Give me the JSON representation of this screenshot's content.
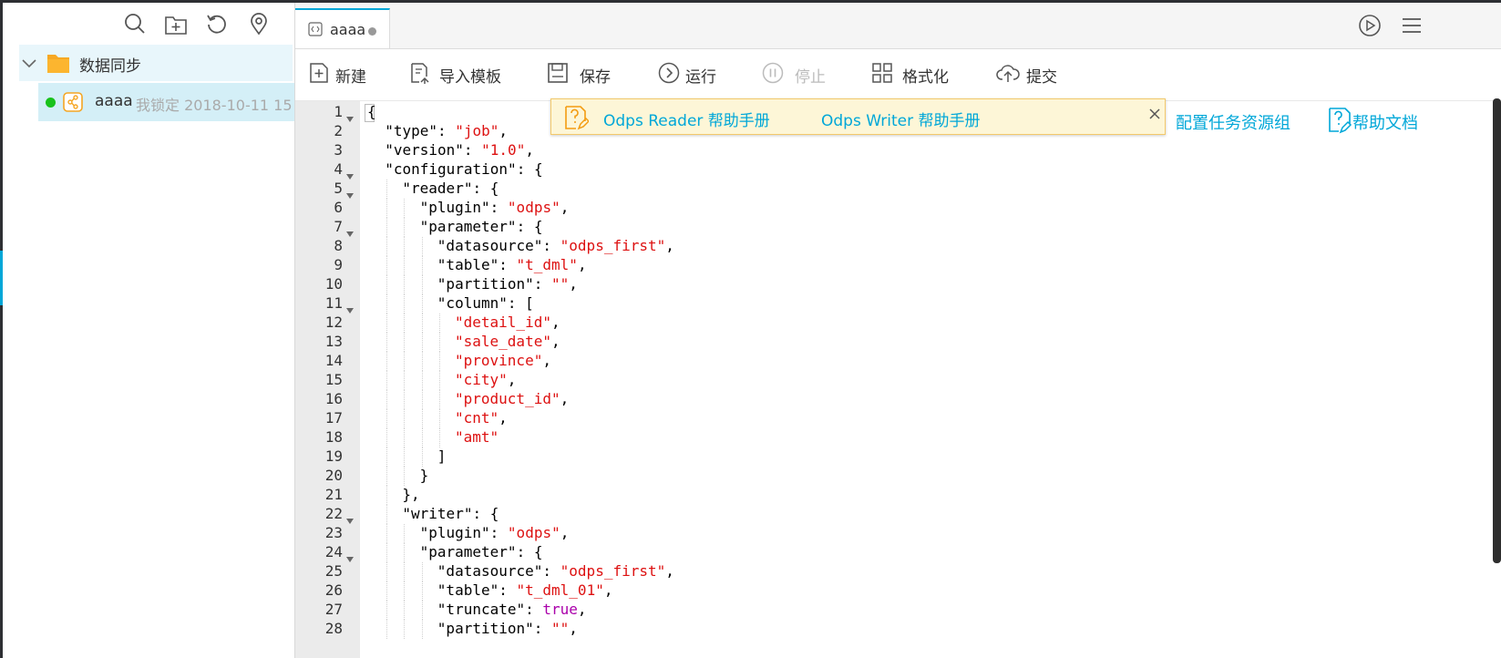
{
  "sidebar": {
    "folder": {
      "label": "数据同步"
    },
    "item": {
      "name": "aaaa",
      "lock_info": "我锁定 2018-10-11 15"
    },
    "tools": [
      "search-icon",
      "new-folder-icon",
      "refresh-icon",
      "locate-icon"
    ]
  },
  "tab": {
    "label": "aaaa"
  },
  "toolbar": {
    "new": "新建",
    "import_template": "导入模板",
    "save": "保存",
    "run": "运行",
    "stop": "停止",
    "format": "格式化",
    "submit": "提交"
  },
  "banner": {
    "reader_link": "Odps Reader 帮助手册",
    "writer_link": "Odps Writer 帮助手册"
  },
  "side_links": {
    "resource_group": "配置任务资源组",
    "help_doc": "帮助文档"
  },
  "editor": {
    "lines": [
      {
        "n": "1",
        "fold": true,
        "indent": 0,
        "parts": [
          [
            "p",
            "{"
          ]
        ]
      },
      {
        "n": "2",
        "fold": false,
        "indent": 1,
        "parts": [
          [
            "k",
            "\"type\""
          ],
          [
            "p",
            ": "
          ],
          [
            "s",
            "\"job\""
          ],
          [
            "p",
            ","
          ]
        ]
      },
      {
        "n": "3",
        "fold": false,
        "indent": 1,
        "parts": [
          [
            "k",
            "\"version\""
          ],
          [
            "p",
            ": "
          ],
          [
            "s",
            "\"1.0\""
          ],
          [
            "p",
            ","
          ]
        ]
      },
      {
        "n": "4",
        "fold": true,
        "indent": 1,
        "parts": [
          [
            "k",
            "\"configuration\""
          ],
          [
            "p",
            ": {"
          ]
        ]
      },
      {
        "n": "5",
        "fold": true,
        "indent": 2,
        "parts": [
          [
            "k",
            "\"reader\""
          ],
          [
            "p",
            ": {"
          ]
        ]
      },
      {
        "n": "6",
        "fold": false,
        "indent": 3,
        "parts": [
          [
            "k",
            "\"plugin\""
          ],
          [
            "p",
            ": "
          ],
          [
            "s",
            "\"odps\""
          ],
          [
            "p",
            ","
          ]
        ]
      },
      {
        "n": "7",
        "fold": true,
        "indent": 3,
        "parts": [
          [
            "k",
            "\"parameter\""
          ],
          [
            "p",
            ": {"
          ]
        ]
      },
      {
        "n": "8",
        "fold": false,
        "indent": 4,
        "parts": [
          [
            "k",
            "\"datasource\""
          ],
          [
            "p",
            ": "
          ],
          [
            "s",
            "\"odps_first\""
          ],
          [
            "p",
            ","
          ]
        ]
      },
      {
        "n": "9",
        "fold": false,
        "indent": 4,
        "parts": [
          [
            "k",
            "\"table\""
          ],
          [
            "p",
            ": "
          ],
          [
            "s",
            "\"t_dml\""
          ],
          [
            "p",
            ","
          ]
        ]
      },
      {
        "n": "10",
        "fold": false,
        "indent": 4,
        "parts": [
          [
            "k",
            "\"partition\""
          ],
          [
            "p",
            ": "
          ],
          [
            "s",
            "\"\""
          ],
          [
            "p",
            ","
          ]
        ]
      },
      {
        "n": "11",
        "fold": true,
        "indent": 4,
        "parts": [
          [
            "k",
            "\"column\""
          ],
          [
            "p",
            ": ["
          ]
        ]
      },
      {
        "n": "12",
        "fold": false,
        "indent": 5,
        "parts": [
          [
            "s",
            "\"detail_id\""
          ],
          [
            "p",
            ","
          ]
        ]
      },
      {
        "n": "13",
        "fold": false,
        "indent": 5,
        "parts": [
          [
            "s",
            "\"sale_date\""
          ],
          [
            "p",
            ","
          ]
        ]
      },
      {
        "n": "14",
        "fold": false,
        "indent": 5,
        "parts": [
          [
            "s",
            "\"province\""
          ],
          [
            "p",
            ","
          ]
        ]
      },
      {
        "n": "15",
        "fold": false,
        "indent": 5,
        "parts": [
          [
            "s",
            "\"city\""
          ],
          [
            "p",
            ","
          ]
        ]
      },
      {
        "n": "16",
        "fold": false,
        "indent": 5,
        "parts": [
          [
            "s",
            "\"product_id\""
          ],
          [
            "p",
            ","
          ]
        ]
      },
      {
        "n": "17",
        "fold": false,
        "indent": 5,
        "parts": [
          [
            "s",
            "\"cnt\""
          ],
          [
            "p",
            ","
          ]
        ]
      },
      {
        "n": "18",
        "fold": false,
        "indent": 5,
        "parts": [
          [
            "s",
            "\"amt\""
          ]
        ]
      },
      {
        "n": "19",
        "fold": false,
        "indent": 4,
        "parts": [
          [
            "p",
            "]"
          ]
        ]
      },
      {
        "n": "20",
        "fold": false,
        "indent": 3,
        "parts": [
          [
            "p",
            "}"
          ]
        ]
      },
      {
        "n": "21",
        "fold": false,
        "indent": 2,
        "parts": [
          [
            "p",
            "},"
          ]
        ]
      },
      {
        "n": "22",
        "fold": true,
        "indent": 2,
        "parts": [
          [
            "k",
            "\"writer\""
          ],
          [
            "p",
            ": {"
          ]
        ]
      },
      {
        "n": "23",
        "fold": false,
        "indent": 3,
        "parts": [
          [
            "k",
            "\"plugin\""
          ],
          [
            "p",
            ": "
          ],
          [
            "s",
            "\"odps\""
          ],
          [
            "p",
            ","
          ]
        ]
      },
      {
        "n": "24",
        "fold": true,
        "indent": 3,
        "parts": [
          [
            "k",
            "\"parameter\""
          ],
          [
            "p",
            ": {"
          ]
        ]
      },
      {
        "n": "25",
        "fold": false,
        "indent": 4,
        "parts": [
          [
            "k",
            "\"datasource\""
          ],
          [
            "p",
            ": "
          ],
          [
            "s",
            "\"odps_first\""
          ],
          [
            "p",
            ","
          ]
        ]
      },
      {
        "n": "26",
        "fold": false,
        "indent": 4,
        "parts": [
          [
            "k",
            "\"table\""
          ],
          [
            "p",
            ": "
          ],
          [
            "s",
            "\"t_dml_01\""
          ],
          [
            "p",
            ","
          ]
        ]
      },
      {
        "n": "27",
        "fold": false,
        "indent": 4,
        "parts": [
          [
            "k",
            "\"truncate\""
          ],
          [
            "p",
            ": "
          ],
          [
            "b",
            "true"
          ],
          [
            "p",
            ","
          ]
        ]
      },
      {
        "n": "28",
        "fold": false,
        "indent": 4,
        "parts": [
          [
            "k",
            "\"partition\""
          ],
          [
            "p",
            ": "
          ],
          [
            "s",
            "\"\""
          ],
          [
            "p",
            ","
          ]
        ]
      }
    ]
  }
}
